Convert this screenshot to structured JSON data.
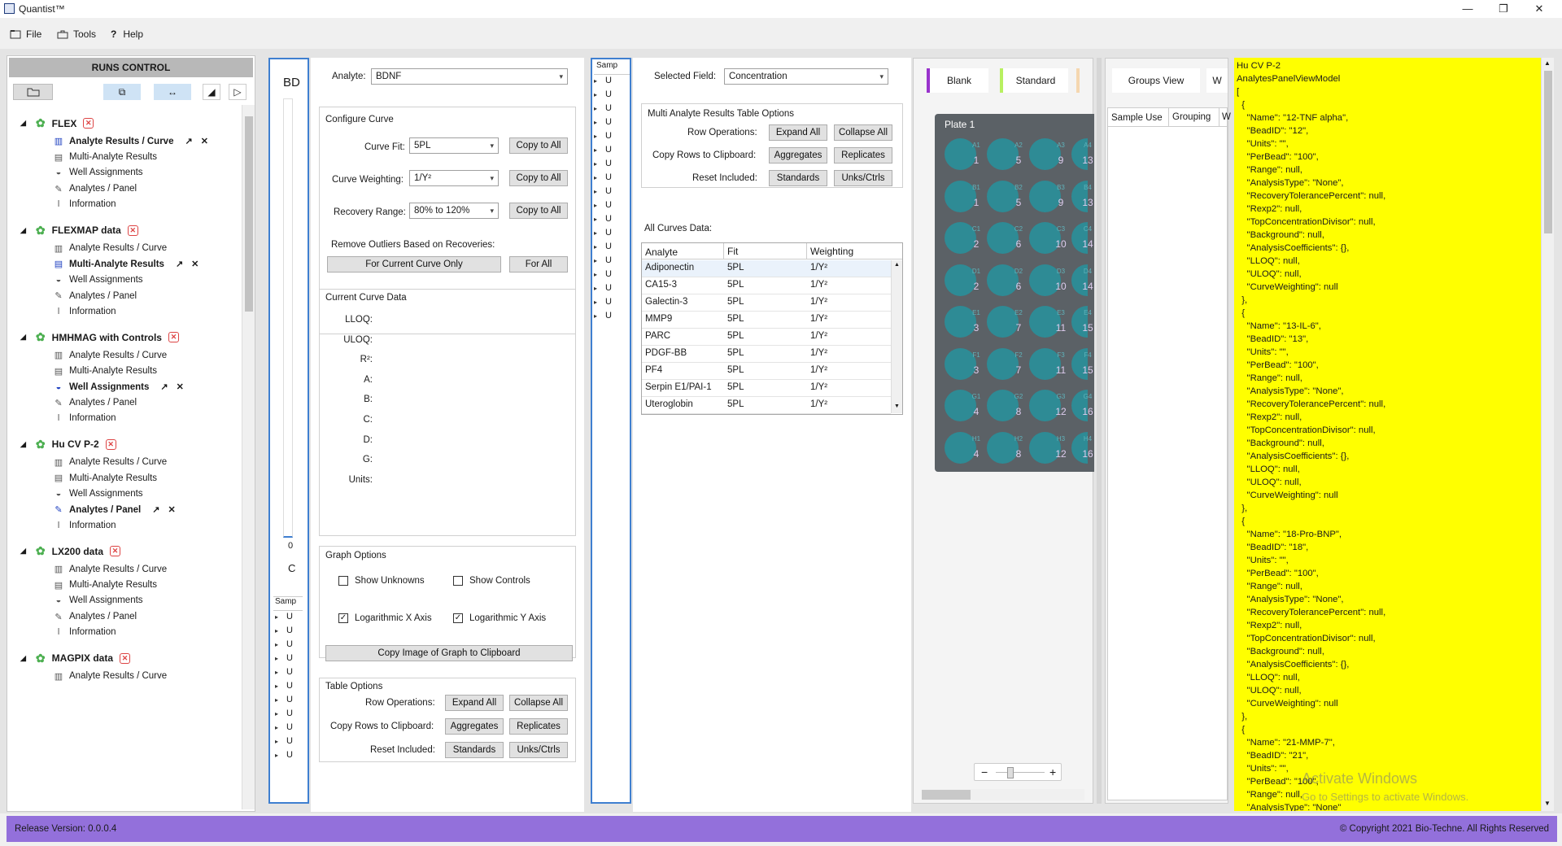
{
  "app": {
    "title": "Quantist™"
  },
  "menu": {
    "file": "File",
    "tools": "Tools",
    "help": "Help"
  },
  "runs": {
    "header": "RUNS CONTROL",
    "runs": [
      {
        "name": "FLEX",
        "items": [
          "Analyte Results / Curve",
          "Multi-Analyte Results",
          "Well Assignments",
          "Analytes / Panel",
          "Information"
        ],
        "active": 0
      },
      {
        "name": "FLEXMAP data",
        "items": [
          "Analyte Results / Curve",
          "Multi-Analyte Results",
          "Well Assignments",
          "Analytes / Panel",
          "Information"
        ],
        "active": 1
      },
      {
        "name": "HMHMAG with Controls",
        "items": [
          "Analyte Results / Curve",
          "Multi-Analyte Results",
          "Well Assignments",
          "Analytes / Panel",
          "Information"
        ],
        "active": 2
      },
      {
        "name": "Hu CV P-2",
        "items": [
          "Analyte Results / Curve",
          "Multi-Analyte Results",
          "Well Assignments",
          "Analytes / Panel",
          "Information"
        ],
        "active": 3
      },
      {
        "name": "LX200 data",
        "items": [
          "Analyte Results / Curve",
          "Multi-Analyte Results",
          "Well Assignments",
          "Analytes / Panel",
          "Information"
        ],
        "active": -1
      },
      {
        "name": "MAGPIX data",
        "items": [
          "Analyte Results / Curve"
        ],
        "active": -1
      }
    ]
  },
  "graph": {
    "title_partial": "BD",
    "axis_0": "0",
    "axis_c": "C",
    "samp": "Samp",
    "row_label": "U"
  },
  "curve": {
    "analyte_label": "Analyte:",
    "analyte_value": "BDNF",
    "configure_title": "Configure Curve",
    "fit_label": "Curve Fit:",
    "fit_value": "5PL",
    "weight_label": "Curve Weighting:",
    "weight_value": "1/Y²",
    "recovery_label": "Recovery Range:",
    "recovery_value": "80% to 120%",
    "copy_all": "Copy to All",
    "outliers_label": "Remove Outliers Based on Recoveries:",
    "for_current": "For Current Curve Only",
    "for_all": "For All",
    "current_title": "Current Curve Data",
    "params": [
      "LLOQ:",
      "ULOQ:",
      "R²:",
      "A:",
      "B:",
      "C:",
      "D:",
      "G:",
      "Units:"
    ],
    "graph_options_title": "Graph Options",
    "show_unknowns": "Show Unknowns",
    "show_controls": "Show Controls",
    "log_x": "Logarithmic X Axis",
    "log_y": "Logarithmic Y Axis",
    "copy_image": "Copy Image of Graph to Clipboard",
    "table_options_title": "Table Options",
    "row_ops": "Row Operations:",
    "expand_all": "Expand All",
    "collapse_all": "Collapse All",
    "copy_rows": "Copy Rows to Clipboard:",
    "aggregates": "Aggregates",
    "replicates": "Replicates",
    "reset_included": "Reset Included:",
    "standards": "Standards",
    "unks": "Unks/Ctrls"
  },
  "samp2": {
    "label": "Samp",
    "row_label": "U"
  },
  "multi": {
    "selected_field_label": "Selected Field:",
    "selected_field_value": "Concentration",
    "options_title": "Multi Analyte Results Table Options",
    "row_ops": "Row Operations:",
    "expand_all": "Expand All",
    "collapse_all": "Collapse All",
    "copy_rows": "Copy Rows to Clipboard:",
    "aggregates": "Aggregates",
    "replicates": "Replicates",
    "reset_included": "Reset Included:",
    "standards": "Standards",
    "unks": "Unks/Ctrls",
    "all_curves": "All Curves Data:",
    "columns": [
      "Analyte",
      "Fit",
      "Weighting"
    ],
    "rows": [
      [
        "Adiponectin",
        "5PL",
        "1/Y²"
      ],
      [
        "CA15-3",
        "5PL",
        "1/Y²"
      ],
      [
        "Galectin-3",
        "5PL",
        "1/Y²"
      ],
      [
        "MMP9",
        "5PL",
        "1/Y²"
      ],
      [
        "PARC",
        "5PL",
        "1/Y²"
      ],
      [
        "PDGF-BB",
        "5PL",
        "1/Y²"
      ],
      [
        "PF4",
        "5PL",
        "1/Y²"
      ],
      [
        "Serpin E1/PAI-1",
        "5PL",
        "1/Y²"
      ],
      [
        "Uteroglobin",
        "5PL",
        "1/Y²"
      ]
    ]
  },
  "plate": {
    "legend": [
      {
        "label": "Blank",
        "color": "#9932cc"
      },
      {
        "label": "Standard",
        "color": "#b8f060"
      }
    ],
    "title": "Plate 1",
    "rows": [
      [
        "1",
        "5",
        "9",
        "13"
      ],
      [
        "1",
        "5",
        "9",
        "13"
      ],
      [
        "2",
        "6",
        "10",
        "14"
      ],
      [
        "2",
        "6",
        "10",
        "14"
      ],
      [
        "3",
        "7",
        "11",
        "15"
      ],
      [
        "3",
        "7",
        "11",
        "15"
      ],
      [
        "4",
        "8",
        "12",
        "16"
      ],
      [
        "4",
        "8",
        "12",
        "16"
      ]
    ],
    "well_ids": [
      [
        "A1",
        "A2",
        "A3",
        "A4"
      ],
      [
        "B1",
        "B2",
        "B3",
        "B4"
      ],
      [
        "C1",
        "C2",
        "C3",
        "C4"
      ],
      [
        "D1",
        "D2",
        "D3",
        "D4"
      ],
      [
        "E1",
        "E2",
        "E3",
        "E4"
      ],
      [
        "F1",
        "F2",
        "F3",
        "F4"
      ],
      [
        "G1",
        "G2",
        "G3",
        "G4"
      ],
      [
        "H1",
        "H2",
        "H3",
        "H4"
      ]
    ],
    "zoom_minus": "−",
    "zoom_plus": "+"
  },
  "groups": {
    "groups_view": "Groups View",
    "col_sample_use": "Sample Use",
    "col_grouping": "Grouping",
    "col_w": "W",
    "partial_tab": "W"
  },
  "json_panel": {
    "text": "Hu CV P-2\nAnalytesPanelViewModel\n[\n  {\n    \"Name\": \"12-TNF alpha\",\n    \"BeadID\": \"12\",\n    \"Units\": \"\",\n    \"PerBead\": \"100\",\n    \"Range\": null,\n    \"AnalysisType\": \"None\",\n    \"RecoveryTolerancePercent\": null,\n    \"Rexp2\": null,\n    \"TopConcentrationDivisor\": null,\n    \"Background\": null,\n    \"AnalysisCoefficients\": {},\n    \"LLOQ\": null,\n    \"ULOQ\": null,\n    \"CurveWeighting\": null\n  },\n  {\n    \"Name\": \"13-IL-6\",\n    \"BeadID\": \"13\",\n    \"Units\": \"\",\n    \"PerBead\": \"100\",\n    \"Range\": null,\n    \"AnalysisType\": \"None\",\n    \"RecoveryTolerancePercent\": null,\n    \"Rexp2\": null,\n    \"TopConcentrationDivisor\": null,\n    \"Background\": null,\n    \"AnalysisCoefficients\": {},\n    \"LLOQ\": null,\n    \"ULOQ\": null,\n    \"CurveWeighting\": null\n  },\n  {\n    \"Name\": \"18-Pro-BNP\",\n    \"BeadID\": \"18\",\n    \"Units\": \"\",\n    \"PerBead\": \"100\",\n    \"Range\": null,\n    \"AnalysisType\": \"None\",\n    \"RecoveryTolerancePercent\": null,\n    \"Rexp2\": null,\n    \"TopConcentrationDivisor\": null,\n    \"Background\": null,\n    \"AnalysisCoefficients\": {},\n    \"LLOQ\": null,\n    \"ULOQ\": null,\n    \"CurveWeighting\": null\n  },\n  {\n    \"Name\": \"21-MMP-7\",\n    \"BeadID\": \"21\",\n    \"Units\": \"\",\n    \"PerBead\": \"100\",\n    \"Range\": null,\n    \"AnalysisType\": \"None\""
  },
  "watermark": {
    "line1": "Activate Windows",
    "line2": "Go to Settings to activate Windows."
  },
  "status": {
    "release": "Release Version: 0.0.0.4",
    "copyright": "© Copyright 2021 Bio-Techne. All Rights Reserved"
  }
}
